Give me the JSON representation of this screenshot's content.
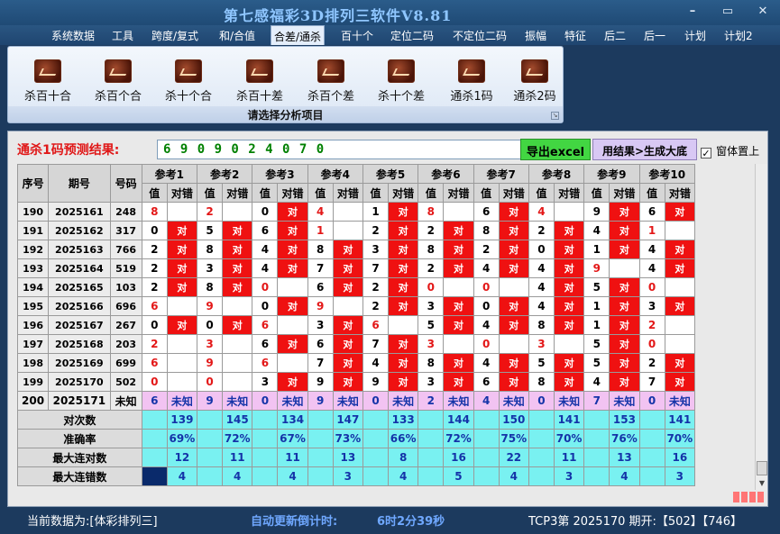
{
  "app": {
    "title": "第七感福彩3D排列三软件V8.81"
  },
  "menu": [
    "系统数据",
    "工具",
    "跨度/复式",
    "和/合值",
    "合差/通杀",
    "百十个",
    "定位二码",
    "不定位二码",
    "振幅",
    "特征",
    "后二",
    "后一",
    "计划",
    "计划2"
  ],
  "menu_active_index": 4,
  "ribbon": {
    "buttons": [
      "杀百十合",
      "杀百个合",
      "杀十个合",
      "杀百十差",
      "杀百个差",
      "杀十个差",
      "通杀1码",
      "通杀2码"
    ],
    "caption": "请选择分析项目"
  },
  "prediction": {
    "label": "通杀1码预测结果:",
    "value": "6 9 0 9 0 2 4 0 7 0"
  },
  "actions": {
    "export": "导出excel",
    "generate": "用结果>生成大底",
    "ontop": "窗体置上",
    "ontop_checked": true
  },
  "table": {
    "headers": {
      "idx": "序号",
      "period": "期号",
      "num": "号码",
      "value": "值",
      "hit": "对错"
    },
    "refs": [
      "参考1",
      "参考2",
      "参考3",
      "参考4",
      "参考5",
      "参考6",
      "参考7",
      "参考8",
      "参考9",
      "参考10"
    ],
    "hit_mark": "对",
    "rows": [
      {
        "idx": "190",
        "period": "2025161",
        "num": "248",
        "cells": [
          [
            "8",
            0
          ],
          [
            "2",
            0
          ],
          [
            "0",
            1
          ],
          [
            "4",
            0
          ],
          [
            "1",
            1
          ],
          [
            "8",
            0
          ],
          [
            "6",
            1
          ],
          [
            "4",
            0
          ],
          [
            "9",
            1
          ],
          [
            "6",
            1
          ]
        ]
      },
      {
        "idx": "191",
        "period": "2025162",
        "num": "317",
        "cells": [
          [
            "0",
            1
          ],
          [
            "5",
            1
          ],
          [
            "6",
            1
          ],
          [
            "1",
            0
          ],
          [
            "2",
            1
          ],
          [
            "2",
            1
          ],
          [
            "8",
            1
          ],
          [
            "2",
            1
          ],
          [
            "4",
            1
          ],
          [
            "1",
            0
          ]
        ]
      },
      {
        "idx": "192",
        "period": "2025163",
        "num": "766",
        "cells": [
          [
            "2",
            1
          ],
          [
            "8",
            1
          ],
          [
            "4",
            1
          ],
          [
            "8",
            1
          ],
          [
            "3",
            1
          ],
          [
            "8",
            1
          ],
          [
            "2",
            1
          ],
          [
            "0",
            1
          ],
          [
            "1",
            1
          ],
          [
            "4",
            1
          ]
        ]
      },
      {
        "idx": "193",
        "period": "2025164",
        "num": "519",
        "cells": [
          [
            "2",
            1
          ],
          [
            "3",
            1
          ],
          [
            "4",
            1
          ],
          [
            "7",
            1
          ],
          [
            "7",
            1
          ],
          [
            "2",
            1
          ],
          [
            "4",
            1
          ],
          [
            "4",
            1
          ],
          [
            "9",
            0
          ],
          [
            "4",
            1
          ]
        ]
      },
      {
        "idx": "194",
        "period": "2025165",
        "num": "103",
        "cells": [
          [
            "2",
            1
          ],
          [
            "8",
            1
          ],
          [
            "0",
            0
          ],
          [
            "6",
            1
          ],
          [
            "2",
            1
          ],
          [
            "0",
            0
          ],
          [
            "0",
            0
          ],
          [
            "4",
            1
          ],
          [
            "5",
            1
          ],
          [
            "0",
            0
          ]
        ]
      },
      {
        "idx": "195",
        "period": "2025166",
        "num": "696",
        "cells": [
          [
            "6",
            0
          ],
          [
            "9",
            0
          ],
          [
            "0",
            1
          ],
          [
            "9",
            0
          ],
          [
            "2",
            1
          ],
          [
            "3",
            1
          ],
          [
            "0",
            1
          ],
          [
            "4",
            1
          ],
          [
            "1",
            1
          ],
          [
            "3",
            1
          ]
        ]
      },
      {
        "idx": "196",
        "period": "2025167",
        "num": "267",
        "cells": [
          [
            "0",
            1
          ],
          [
            "0",
            1
          ],
          [
            "6",
            0
          ],
          [
            "3",
            1
          ],
          [
            "6",
            0
          ],
          [
            "5",
            1
          ],
          [
            "4",
            1
          ],
          [
            "8",
            1
          ],
          [
            "1",
            1
          ],
          [
            "2",
            0
          ]
        ]
      },
      {
        "idx": "197",
        "period": "2025168",
        "num": "203",
        "cells": [
          [
            "2",
            0
          ],
          [
            "3",
            0
          ],
          [
            "6",
            1
          ],
          [
            "6",
            1
          ],
          [
            "7",
            1
          ],
          [
            "3",
            0
          ],
          [
            "0",
            0
          ],
          [
            "3",
            0
          ],
          [
            "5",
            1
          ],
          [
            "0",
            0
          ]
        ]
      },
      {
        "idx": "198",
        "period": "2025169",
        "num": "699",
        "cells": [
          [
            "6",
            0
          ],
          [
            "9",
            0
          ],
          [
            "6",
            0
          ],
          [
            "7",
            1
          ],
          [
            "4",
            1
          ],
          [
            "8",
            1
          ],
          [
            "4",
            1
          ],
          [
            "5",
            1
          ],
          [
            "5",
            1
          ],
          [
            "2",
            1
          ]
        ]
      },
      {
        "idx": "199",
        "period": "2025170",
        "num": "502",
        "cells": [
          [
            "0",
            0
          ],
          [
            "0",
            0
          ],
          [
            "3",
            1
          ],
          [
            "9",
            1
          ],
          [
            "9",
            1
          ],
          [
            "3",
            1
          ],
          [
            "6",
            1
          ],
          [
            "8",
            1
          ],
          [
            "4",
            1
          ],
          [
            "7",
            1
          ]
        ]
      }
    ],
    "unknown_row": {
      "idx": "200",
      "period": "2025171",
      "num": "未知",
      "values": [
        "6",
        "9",
        "0",
        "9",
        "0",
        "2",
        "4",
        "0",
        "7",
        "0"
      ],
      "label": "未知"
    },
    "stats": [
      {
        "label": "对次数",
        "values": [
          "139",
          "145",
          "134",
          "147",
          "133",
          "144",
          "150",
          "141",
          "153",
          "141"
        ]
      },
      {
        "label": "准确率",
        "values": [
          "69%",
          "72%",
          "67%",
          "73%",
          "66%",
          "72%",
          "75%",
          "70%",
          "76%",
          "70%"
        ]
      },
      {
        "label": "最大连对数",
        "values": [
          "12",
          "11",
          "11",
          "13",
          "8",
          "16",
          "22",
          "11",
          "13",
          "16"
        ]
      },
      {
        "label": "最大连错数",
        "values": [
          "4",
          "4",
          "4",
          "3",
          "4",
          "5",
          "4",
          "3",
          "4",
          "3"
        ]
      }
    ]
  },
  "colors": {
    "red_hit": "#ef1111",
    "stat_bg": "#79f1f1",
    "unknown_bg": "#f2c3f2",
    "value_text": "#1433a8"
  },
  "status": {
    "data_source": "当前数据为:[体彩排列三]",
    "countdown_label": "自动更新倒计时:",
    "countdown": "6时2分39秒",
    "latest": "TCP3第 2025170 期开:【502】【746】"
  }
}
